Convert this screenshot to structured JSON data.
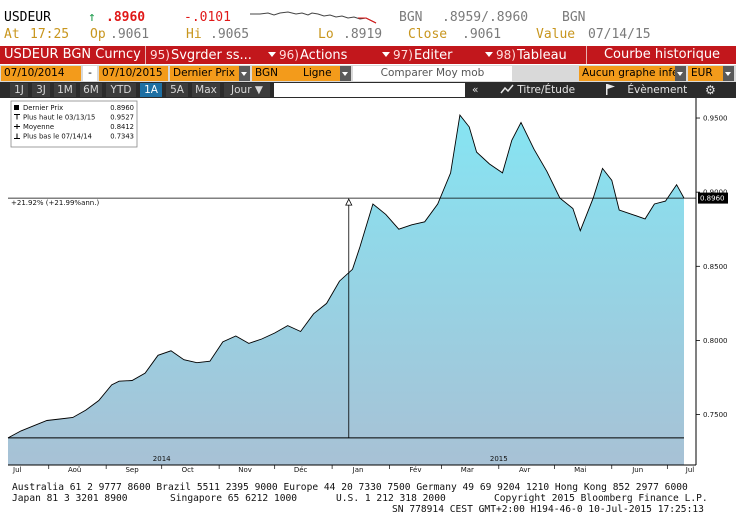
{
  "quote": {
    "ticker": "USDEUR",
    "arrow": "↑",
    "last": ".8960",
    "change": "-.0101",
    "source": "BGN",
    "bid_ask": ".8959/.8960",
    "source2": "BGN",
    "at_label": "At",
    "at_time": "17:25",
    "op_label": "Op",
    "op_value": ".9061",
    "hi_label": "Hi",
    "hi_value": ".9065",
    "lo_label": "Lo",
    "lo_value": ".8919",
    "close_label": "Close",
    "close_value": ".9061",
    "value_label": "Value",
    "value_date": "07/14/15"
  },
  "menu": {
    "title": "USDEUR BGN Curncy",
    "items": [
      {
        "num": "95)",
        "label": "Svgrder ss..."
      },
      {
        "num": "96)",
        "label": "Actions"
      },
      {
        "num": "97)",
        "label": "Editer"
      },
      {
        "num": "98)",
        "label": "Tableau"
      }
    ],
    "right": "Courbe historique"
  },
  "params": {
    "start_date": "07/10/2014",
    "sep": "-",
    "end_date": "07/10/2015",
    "field": "Dernier Prix",
    "source": "BGN",
    "style": "Ligne",
    "compare": "Comparer Moy mob",
    "graph": "Aucun graphe infé",
    "currency": "EUR"
  },
  "toolbar": {
    "ranges": [
      "1J",
      "3J",
      "1M",
      "6M",
      "YTD",
      "1A",
      "5A",
      "Max"
    ],
    "selected": "1A",
    "period": "Jour",
    "collapse": "«",
    "title_label": "Titre/Étude",
    "event_label": "Évènement",
    "gear": "gear-icon"
  },
  "chart_data": {
    "type": "area",
    "title": "",
    "xlabel": "",
    "ylabel": "",
    "ylim": [
      0.716,
      0.9635
    ],
    "x_start": "2014-07-10",
    "x_end": "2015-07-10",
    "y_ticks": [
      "0.9500",
      "0.9000",
      "0.8500",
      "0.8000",
      "0.7500"
    ],
    "y_tick_values": [
      0.95,
      0.9,
      0.85,
      0.8,
      0.75
    ],
    "x_month_ticks": [
      "Jul",
      "Aoû",
      "Sep",
      "Oct",
      "Nov",
      "Déc",
      "Jan",
      "Fév",
      "Mar",
      "Avr",
      "Mai",
      "Jun",
      "Jul"
    ],
    "x_year_labels": [
      "2014",
      "2015"
    ],
    "last_value_label": "0.8960",
    "last_value": 0.896,
    "change_annotation": "+21.92% (+21.99%ann.)",
    "low_line": 0.7343,
    "series": [
      {
        "name": "Dernier Prix",
        "values": [
          [
            "2014-07-10",
            0.7343
          ],
          [
            "2014-07-17",
            0.739
          ],
          [
            "2014-07-24",
            0.7425
          ],
          [
            "2014-07-31",
            0.746
          ],
          [
            "2014-08-07",
            0.747
          ],
          [
            "2014-08-14",
            0.748
          ],
          [
            "2014-08-21",
            0.753
          ],
          [
            "2014-08-28",
            0.7595
          ],
          [
            "2014-09-04",
            0.77
          ],
          [
            "2014-09-08",
            0.7725
          ],
          [
            "2014-09-15",
            0.773
          ],
          [
            "2014-09-22",
            0.778
          ],
          [
            "2014-09-29",
            0.79
          ],
          [
            "2014-10-06",
            0.793
          ],
          [
            "2014-10-13",
            0.787
          ],
          [
            "2014-10-20",
            0.785
          ],
          [
            "2014-10-27",
            0.786
          ],
          [
            "2014-11-03",
            0.799
          ],
          [
            "2014-11-10",
            0.803
          ],
          [
            "2014-11-17",
            0.798
          ],
          [
            "2014-11-24",
            0.801
          ],
          [
            "2014-12-01",
            0.805
          ],
          [
            "2014-12-08",
            0.81
          ],
          [
            "2014-12-15",
            0.806
          ],
          [
            "2014-12-22",
            0.818
          ],
          [
            "2014-12-29",
            0.825
          ],
          [
            "2015-01-05",
            0.84
          ],
          [
            "2015-01-12",
            0.848
          ],
          [
            "2015-01-16",
            0.863
          ],
          [
            "2015-01-23",
            0.892
          ],
          [
            "2015-01-30",
            0.885
          ],
          [
            "2015-02-06",
            0.875
          ],
          [
            "2015-02-13",
            0.878
          ],
          [
            "2015-02-20",
            0.88
          ],
          [
            "2015-02-27",
            0.892
          ],
          [
            "2015-03-06",
            0.913
          ],
          [
            "2015-03-11",
            0.952
          ],
          [
            "2015-03-16",
            0.944
          ],
          [
            "2015-03-20",
            0.927
          ],
          [
            "2015-03-27",
            0.919
          ],
          [
            "2015-04-03",
            0.913
          ],
          [
            "2015-04-08",
            0.935
          ],
          [
            "2015-04-13",
            0.947
          ],
          [
            "2015-04-20",
            0.929
          ],
          [
            "2015-04-27",
            0.914
          ],
          [
            "2015-05-04",
            0.896
          ],
          [
            "2015-05-11",
            0.889
          ],
          [
            "2015-05-15",
            0.874
          ],
          [
            "2015-05-22",
            0.896
          ],
          [
            "2015-05-27",
            0.916
          ],
          [
            "2015-06-01",
            0.908
          ],
          [
            "2015-06-05",
            0.888
          ],
          [
            "2015-06-12",
            0.885
          ],
          [
            "2015-06-19",
            0.882
          ],
          [
            "2015-06-24",
            0.892
          ],
          [
            "2015-06-30",
            0.894
          ],
          [
            "2015-07-06",
            0.905
          ],
          [
            "2015-07-10",
            0.896
          ]
        ]
      }
    ],
    "legend": [
      {
        "label": "Dernier Prix",
        "value": "0.8960"
      },
      {
        "label": "Plus haut le 03/13/15",
        "value": "0.9527"
      },
      {
        "label": "Moyenne",
        "value": "0.8412"
      },
      {
        "label": "Plus bas le 07/14/14",
        "value": "0.7343"
      }
    ],
    "colors": {
      "line": "#000000",
      "fill_top": "#7fe3f2",
      "fill_bottom": "#a3bed3"
    },
    "grid": true
  },
  "footer": {
    "line1": "Australia 61 2 9777 8600 Brazil 5511 2395 9000 Europe 44 20 7330 7500 Germany 49 69 9204 1210 Hong Kong 852 2977 6000",
    "line2a": "Japan 81 3 3201 8900",
    "line2b": "Singapore 65 6212 1000",
    "line2c": "U.S. 1 212 318 2000",
    "line2d": "Copyright 2015 Bloomberg Finance L.P.",
    "line3": "SN 778914 CEST GMT+2:00 H194-46-0 10-Jul-2015 17:25:13"
  }
}
